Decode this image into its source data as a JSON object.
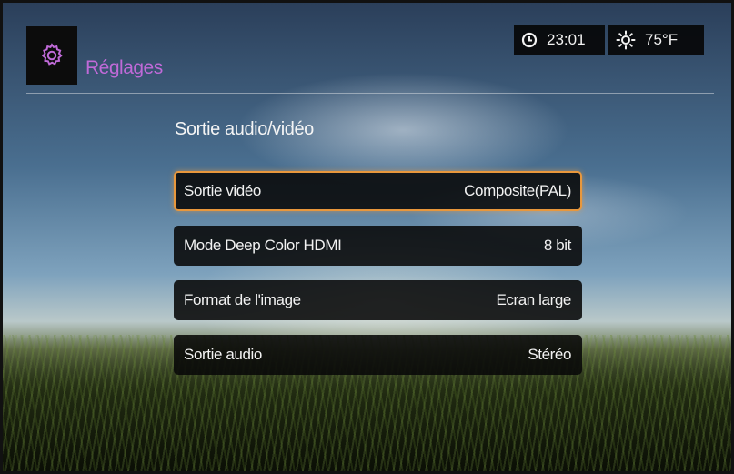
{
  "header": {
    "title": "Réglages",
    "icon": "gear-icon",
    "accent_color": "#c06ad8"
  },
  "status": {
    "time": "23:01",
    "temperature": "75°F",
    "clock_icon": "clock-icon",
    "weather_icon": "sun-icon"
  },
  "section": {
    "title": "Sortie audio/vidéo"
  },
  "menu": {
    "selected_index": 0,
    "items": [
      {
        "label": "Sortie vidéo",
        "value": "Composite(PAL)"
      },
      {
        "label": "Mode Deep Color HDMI",
        "value": "8 bit"
      },
      {
        "label": "Format de l'image",
        "value": "Ecran large"
      },
      {
        "label": "Sortie audio",
        "value": "Stéréo"
      }
    ]
  }
}
